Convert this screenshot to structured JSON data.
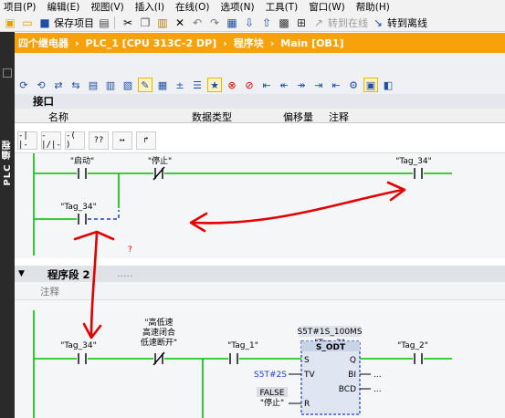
{
  "menu": [
    "项目(P)",
    "编辑(E)",
    "视图(V)",
    "插入(I)",
    "在线(O)",
    "选项(N)",
    "工具(T)",
    "窗口(W)",
    "帮助(H)"
  ],
  "toolbar": {
    "save_label": "保存项目",
    "go_online_label": "转到在线",
    "go_offline_label": "转到离线"
  },
  "left_strip_label": "PLC 编程",
  "breadcrumb": [
    "四个继电器",
    "PLC_1 [CPU 313C-2 DP]",
    "程序块",
    "Main [OB1]"
  ],
  "interface": {
    "title": "接口",
    "columns": [
      "名称",
      "数据类型",
      "偏移量",
      "注释"
    ]
  },
  "network1": {
    "contact_start": "\"启动\"",
    "contact_stop": "\"停止\"",
    "coil": "\"Tag_34\"",
    "contact_self": "\"Tag_34\""
  },
  "network2": {
    "title": "程序段 2",
    "dots": ".....",
    "comment_label": "注释",
    "contact_tag34": "\"Tag_34\"",
    "contact_desc_lines": [
      "\"高低速",
      "高速闭合",
      "低速断开\""
    ],
    "contact_tag1": "\"Tag_1\"",
    "timer_preset": "S5T#1S_100MS",
    "timer_name": "\"Tag_2\"",
    "timer_type": "S_ODT",
    "pin_s": "S",
    "pin_tv": "TV",
    "pin_r": "R",
    "pin_q": "Q",
    "pin_bi": "BI",
    "pin_bcd": "BCD",
    "tv_value": "S5T#2S",
    "r_value": "FALSE",
    "r_tag": "\"停止\"",
    "out_dots": "...",
    "coil": "\"Tag_2\""
  },
  "annotation": {
    "question_mark": "?"
  },
  "colors": {
    "breadcrumb_bg": "#f7a20b",
    "power_rail": "#00c000",
    "annotation": "#e00000",
    "dashed_wire": "#1f3fbf"
  }
}
